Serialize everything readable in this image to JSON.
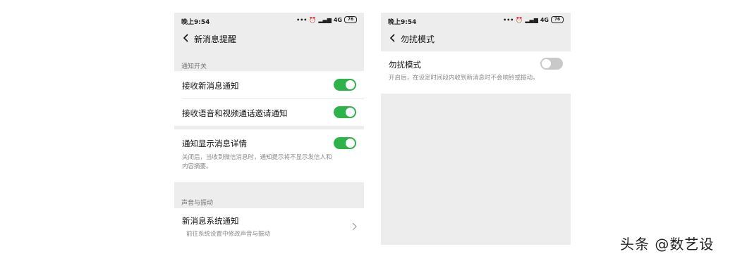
{
  "left_screen": {
    "status": {
      "time": "晚上9:54",
      "network": "4G",
      "battery": "76"
    },
    "title": "新消息提醒",
    "section1_label": "通知开关",
    "items": [
      {
        "label": "接收新消息通知",
        "toggle": true
      },
      {
        "label": "接收语音和视频通话邀请通知",
        "toggle": true
      },
      {
        "label": "通知显示消息详情",
        "toggle": true,
        "description_line1": "关闭后，当收到微信消息时，通知提示将不显示发信人和",
        "description_line2": "内容摘要。"
      }
    ],
    "section2_label": "声音与振动",
    "system_item": {
      "label": "新消息系统通知",
      "description": "前往系统设置中修改声音与振动"
    }
  },
  "right_screen": {
    "status": {
      "time": "晚上9:54",
      "network": "4G",
      "battery": "76"
    },
    "title": "勿扰模式",
    "dnd": {
      "label": "勿扰模式",
      "toggle": false,
      "description": "开启后，在设定时间段内收到新消息时不会响铃或振动。"
    }
  },
  "watermark": "头条 @数艺设",
  "colors": {
    "toggle_on": "#2db34a",
    "toggle_off": "#c9c9c9",
    "background": "#ededed"
  }
}
